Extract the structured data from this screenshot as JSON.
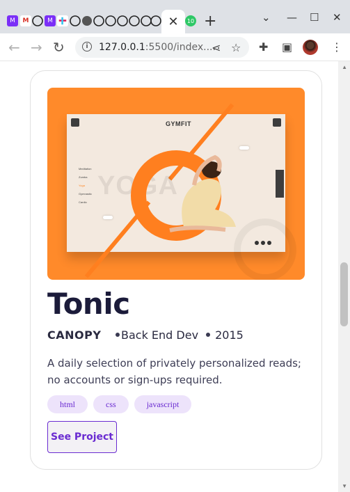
{
  "browser": {
    "tabs": [
      {
        "icon": "purple-app-icon",
        "glyph": "M"
      },
      {
        "icon": "gmail-icon",
        "glyph": "M"
      },
      {
        "icon": "github-icon",
        "glyph": ""
      },
      {
        "icon": "purple-app-icon",
        "glyph": "M"
      },
      {
        "icon": "slack-icon",
        "glyph": ""
      },
      {
        "icon": "github-icon",
        "glyph": ""
      }
    ],
    "active_tab_close": "✕",
    "active_tab_badge": "10",
    "new_tab": "+",
    "address": {
      "host": "127.0.0.1",
      "rest": ":5500/index...."
    }
  },
  "project": {
    "title": "Tonic",
    "company": "CANOPY",
    "role": "Back End Dev",
    "year": "2015",
    "description": "A daily selection of privately personalized reads; no accounts or sign-ups required.",
    "tags": [
      "html",
      "css",
      "javascript"
    ],
    "cta": "See Project",
    "screenshot": {
      "logo": "GYMFIT",
      "menu": [
        "Meditation",
        "Zumba",
        "Yoga",
        "Gymnastic",
        "Cardio"
      ],
      "bg_word": "YOGA",
      "accent": "#ff8a2a"
    }
  },
  "colors": {
    "accent_orange": "#ff8a2a",
    "tag_bg": "#ede3fb",
    "brand_purple": "#6a2bd1",
    "title": "#1b1b3a"
  }
}
